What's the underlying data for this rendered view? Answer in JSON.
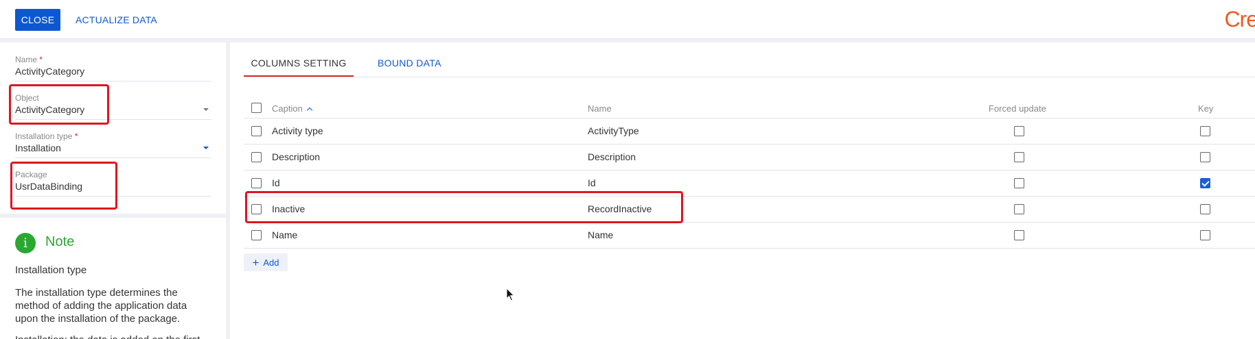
{
  "toolbar": {
    "close_label": "CLOSE",
    "actualize_label": "ACTUALIZE DATA",
    "logo_text": "Cre"
  },
  "form": {
    "name": {
      "label": "Name",
      "required_mark": "*",
      "value": "ActivityCategory"
    },
    "object": {
      "label": "Object",
      "value": "ActivityCategory"
    },
    "installation_type": {
      "label": "Installation type",
      "required_mark": "*",
      "value": "Installation"
    },
    "package": {
      "label": "Package",
      "value": "UsrDataBinding"
    }
  },
  "note": {
    "icon": "info-icon",
    "icon_glyph": "i",
    "title": "Note",
    "subtitle": "Installation type",
    "body": "The installation type determines the method of adding the application data upon the installation of the package.",
    "more": "Installation: the data is added on the first"
  },
  "tabs": [
    {
      "label": "COLUMNS SETTING",
      "active": true
    },
    {
      "label": "BOUND DATA",
      "active": false
    }
  ],
  "grid": {
    "columns": {
      "caption": "Caption",
      "name": "Name",
      "forced_update": "Forced update",
      "key": "Key"
    },
    "sort_icon": "chevron-up-icon",
    "rows": [
      {
        "caption": "Activity type",
        "name": "ActivityType",
        "forced": false,
        "key": false
      },
      {
        "caption": "Description",
        "name": "Description",
        "forced": false,
        "key": false
      },
      {
        "caption": "Id",
        "name": "Id",
        "forced": false,
        "key": true
      },
      {
        "caption": "Inactive",
        "name": "RecordInactive",
        "forced": false,
        "key": false
      },
      {
        "caption": "Name",
        "name": "Name",
        "forced": false,
        "key": false
      }
    ]
  },
  "add_label": "Add",
  "colors": {
    "primary": "#0d58d2",
    "highlight": "#e0141e",
    "note_green": "#2aa832",
    "logo": "#f15a22"
  }
}
